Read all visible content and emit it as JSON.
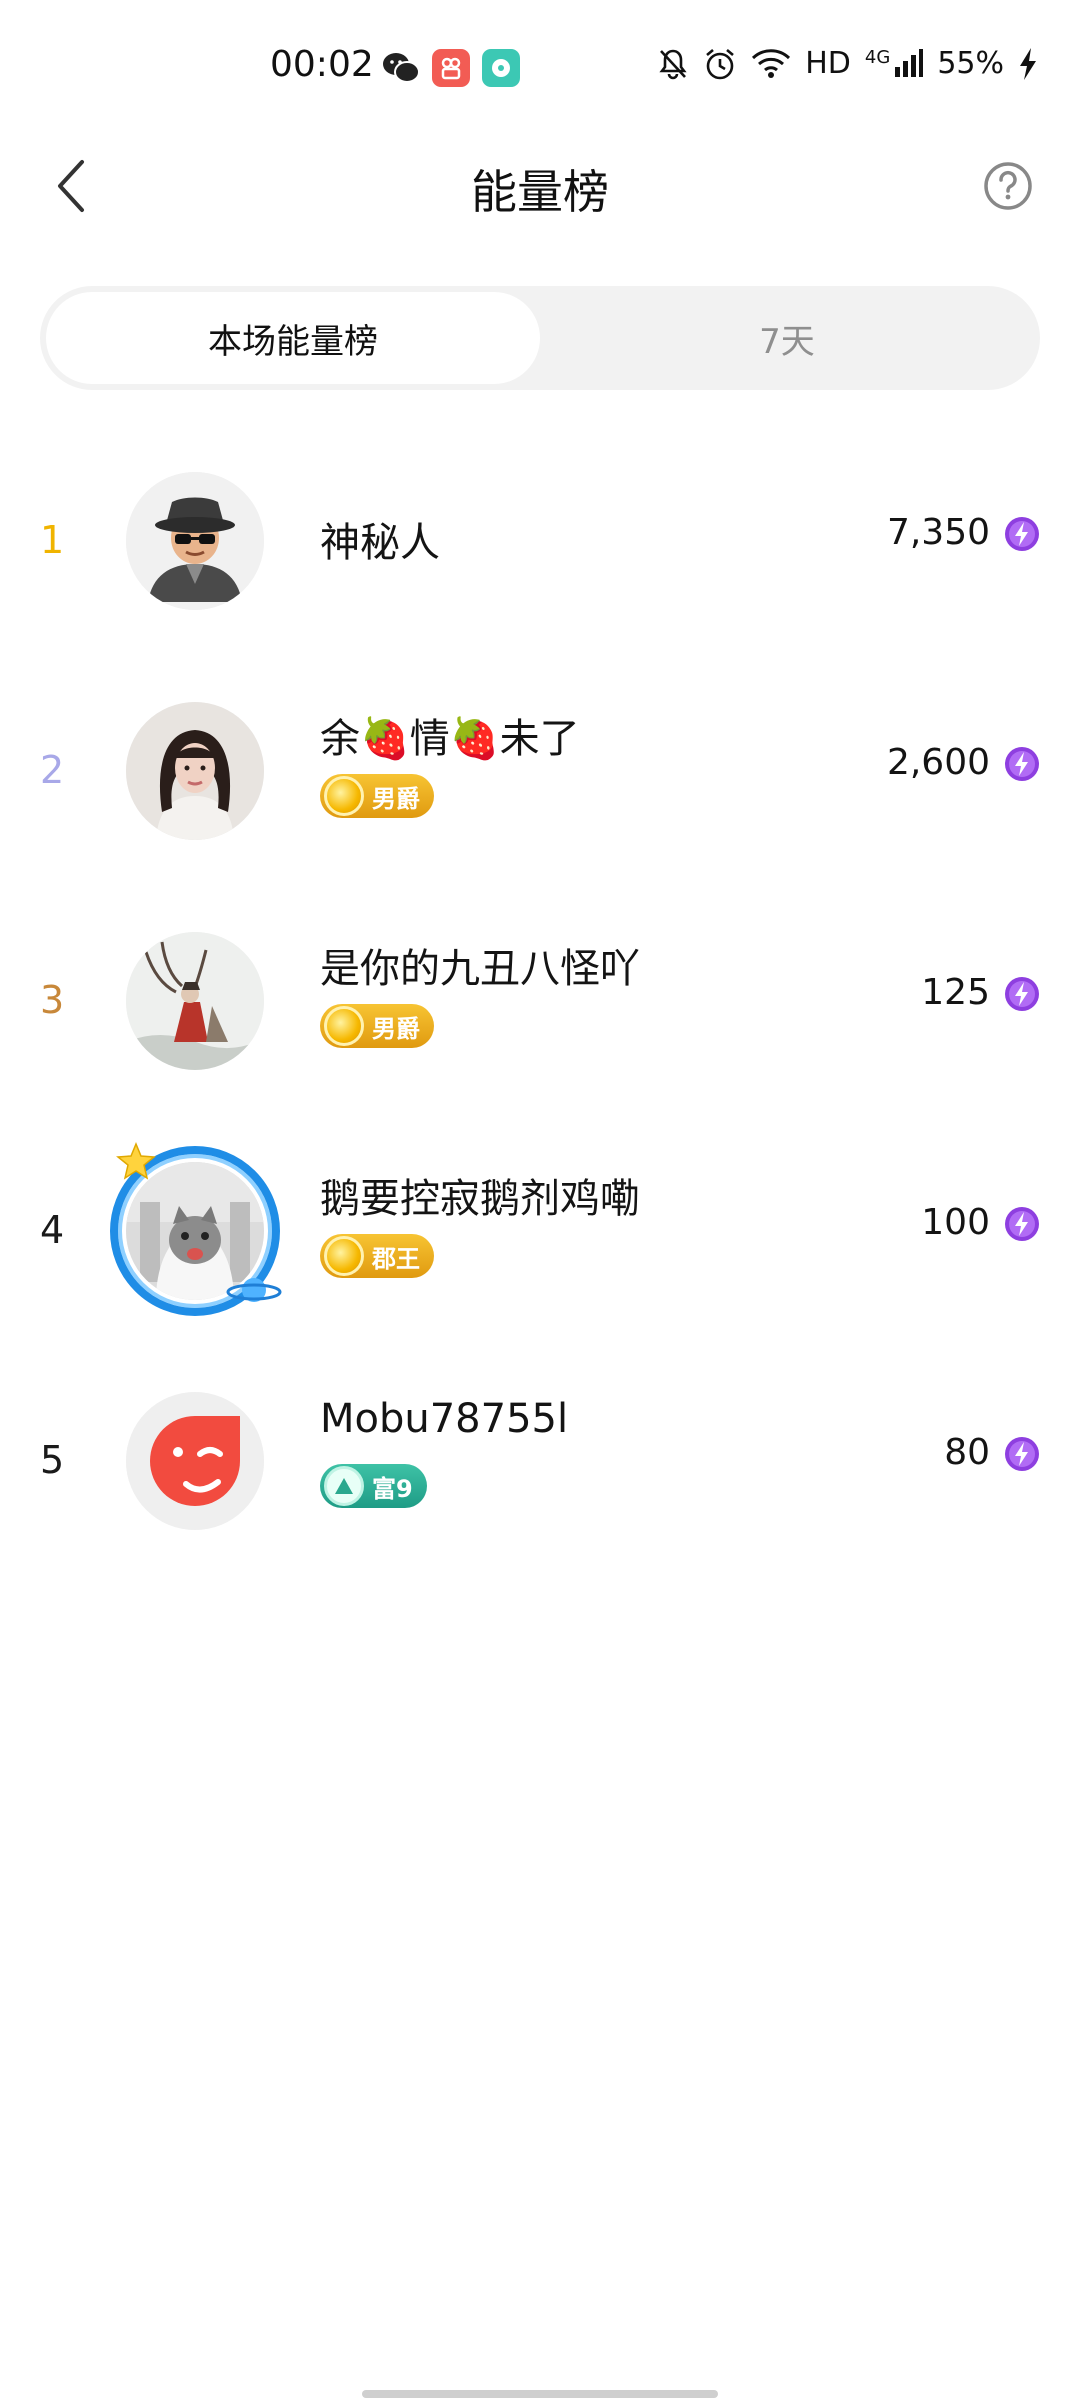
{
  "status_bar": {
    "time": "00:02",
    "network": "HD",
    "signal_type": "4G",
    "battery": "55%",
    "icons": [
      "wechat-icon",
      "video-app-icon",
      "music-app-icon",
      "mute-icon",
      "alarm-icon",
      "wifi-icon",
      "signal-icon",
      "charging-icon"
    ]
  },
  "header": {
    "title": "能量榜",
    "back_icon": "chevron-left-icon",
    "help_icon": "question-circle-icon"
  },
  "tabs": [
    {
      "label": "本场能量榜",
      "active": true
    },
    {
      "label": "7天",
      "active": false
    }
  ],
  "ranking": [
    {
      "rank": "1",
      "name": "神秘人",
      "badge": null,
      "score": "7,350",
      "rank_color": "#f0b400",
      "avatar": "mystery-man"
    },
    {
      "rank": "2",
      "name": "余🍓情🍓未了",
      "badge": {
        "label": "男爵",
        "style": "gold"
      },
      "score": "2,600",
      "rank_color": "#a8a8e8",
      "avatar": "woman-portrait"
    },
    {
      "rank": "3",
      "name": "是你的九丑八怪吖",
      "badge": {
        "label": "男爵",
        "style": "gold"
      },
      "score": "125",
      "rank_color": "#c8883a",
      "avatar": "ink-painting"
    },
    {
      "rank": "4",
      "name": "鹅要控寂鹅剂鸡嘞",
      "badge": {
        "label": "郡王",
        "style": "gold"
      },
      "score": "100",
      "rank_color": "#1a1a1a",
      "avatar": "cat-in-frame"
    },
    {
      "rank": "5",
      "name": "Mobu78755l",
      "badge": {
        "label": "富9",
        "style": "teal"
      },
      "score": "80",
      "rank_color": "#1a1a1a",
      "avatar": "red-wink"
    }
  ],
  "score_icon": "energy-bolt-icon"
}
